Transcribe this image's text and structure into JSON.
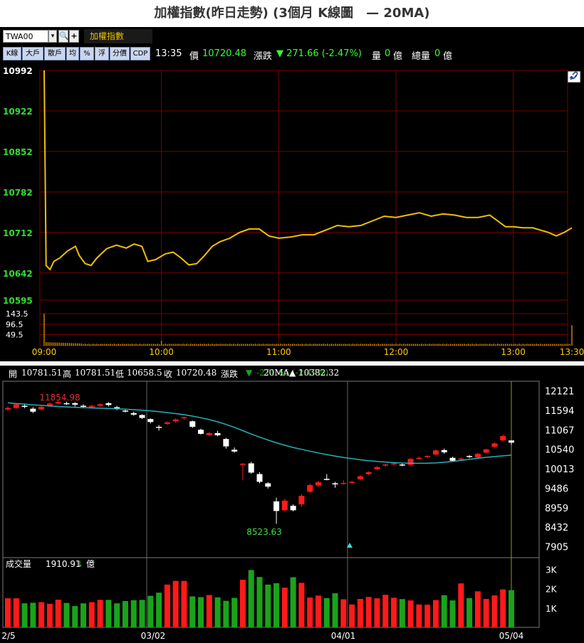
{
  "title": "加權指數(昨日走勢) (3個月 K線圖　— 20MA)",
  "toolbar": {
    "code_value": "TWA00",
    "dropdown_glyph": "▾",
    "zoom_glyph": "🔍",
    "add_glyph": "+",
    "name": "加權指數",
    "buttons": [
      "K線",
      "大戶",
      "散戶",
      "均",
      "%",
      "浮",
      "分價",
      "CDP"
    ],
    "time": "13:35",
    "price_label": "價",
    "price": "10720.48",
    "change_label": "漲跌",
    "change": "▼ 271.66 (-2.47%)",
    "volume_label": "量",
    "volume": "0",
    "volume_unit": "億",
    "total_label": "總量",
    "total": "0",
    "total_unit": "億"
  },
  "colors": {
    "up": "#ff1a1a",
    "down": "#1aa31a",
    "price_line": "#f0c000",
    "ma_line": "#26b0b8",
    "grid": "#7a0000",
    "axis_green": "#33dd33"
  },
  "chart_data": [
    {
      "type": "line",
      "title": "",
      "ylim": [
        10595,
        10992
      ],
      "y_ticks": [
        "10992",
        "10922",
        "10852",
        "10782",
        "10712",
        "10642",
        "10595"
      ],
      "x_ticks": [
        "09:00",
        "10:00",
        "11:00",
        "12:00",
        "13:00",
        "13:30"
      ],
      "x_range_minutes": [
        0,
        270
      ],
      "series": [
        {
          "points": [
            [
              0,
              10992
            ],
            [
              1,
              10655
            ],
            [
              3,
              10648
            ],
            [
              5,
              10662
            ],
            [
              8,
              10668
            ],
            [
              12,
              10680
            ],
            [
              16,
              10688
            ],
            [
              18,
              10672
            ],
            [
              21,
              10658
            ],
            [
              24,
              10655
            ],
            [
              27,
              10668
            ],
            [
              32,
              10684
            ],
            [
              37,
              10690
            ],
            [
              42,
              10685
            ],
            [
              46,
              10692
            ],
            [
              50,
              10688
            ],
            [
              53,
              10662
            ],
            [
              57,
              10665
            ],
            [
              62,
              10675
            ],
            [
              66,
              10678
            ],
            [
              70,
              10668
            ],
            [
              74,
              10656
            ],
            [
              78,
              10658
            ],
            [
              82,
              10672
            ],
            [
              86,
              10688
            ],
            [
              90,
              10696
            ],
            [
              95,
              10702
            ],
            [
              100,
              10712
            ],
            [
              105,
              10718
            ],
            [
              110,
              10718
            ],
            [
              115,
              10706
            ],
            [
              120,
              10702
            ],
            [
              126,
              10704
            ],
            [
              132,
              10708
            ],
            [
              138,
              10708
            ],
            [
              144,
              10716
            ],
            [
              150,
              10724
            ],
            [
              156,
              10722
            ],
            [
              162,
              10724
            ],
            [
              168,
              10732
            ],
            [
              174,
              10740
            ],
            [
              180,
              10738
            ],
            [
              186,
              10742
            ],
            [
              192,
              10746
            ],
            [
              198,
              10740
            ],
            [
              204,
              10744
            ],
            [
              210,
              10742
            ],
            [
              216,
              10738
            ],
            [
              222,
              10738
            ],
            [
              228,
              10742
            ],
            [
              232,
              10732
            ],
            [
              236,
              10722
            ],
            [
              240,
              10722
            ],
            [
              245,
              10720
            ],
            [
              250,
              10720
            ],
            [
              254,
              10716
            ],
            [
              258,
              10712
            ],
            [
              262,
              10706
            ],
            [
              266,
              10712
            ],
            [
              270,
              10720
            ]
          ],
          "close": 10720.48
        }
      ],
      "volume_ticks": [
        "143.5",
        "96.5",
        "49.5"
      ],
      "volume_max": 150,
      "volume_spikes": [
        [
          0,
          143
        ],
        [
          60,
          22
        ],
        [
          270,
          92
        ]
      ],
      "volume_base": 10
    },
    {
      "type": "candlestick",
      "header": {
        "open_label": "開",
        "open": "10781.51",
        "high_label": "高",
        "high": "10781.51",
        "low_label": "低",
        "low": "10658.5",
        "close_label": "收",
        "close": "10720.48",
        "change_label": "漲跌",
        "change": "-271.66 (-2.47%)",
        "ma_label": "20MA",
        "ma_value": "▲ 10382.32"
      },
      "y_ticks": [
        "12121",
        "11594",
        "11067",
        "10540",
        "10013",
        "9486",
        "8959",
        "8432",
        "7905"
      ],
      "ylim": [
        7645,
        12384
      ],
      "x_ticks": [
        "2/5",
        "03/02",
        "04/01",
        "05/04"
      ],
      "annotations": [
        {
          "text": "11854.98",
          "kind": "high"
        },
        {
          "text": "8523.63",
          "kind": "low"
        }
      ],
      "candles": [
        [
          11620,
          11660,
          11700,
          11580
        ],
        [
          11660,
          11760,
          11790,
          11630
        ],
        [
          11720,
          11690,
          11760,
          11650
        ],
        [
          11640,
          11560,
          11680,
          11520
        ],
        [
          11620,
          11690,
          11720,
          11590
        ],
        [
          11720,
          11780,
          11810,
          11690
        ],
        [
          11780,
          11820,
          11855,
          11760
        ],
        [
          11790,
          11780,
          11830,
          11740
        ],
        [
          11790,
          11750,
          11820,
          11700
        ],
        [
          11720,
          11700,
          11760,
          11660
        ],
        [
          11680,
          11720,
          11740,
          11640
        ],
        [
          11720,
          11760,
          11790,
          11690
        ],
        [
          11790,
          11740,
          11820,
          11700
        ],
        [
          11680,
          11650,
          11720,
          11600
        ],
        [
          11590,
          11570,
          11640,
          11540
        ],
        [
          11520,
          11480,
          11560,
          11450
        ],
        [
          11470,
          11390,
          11490,
          11360
        ],
        [
          11360,
          11280,
          11380,
          11240
        ],
        [
          11150,
          11130,
          11200,
          11050
        ],
        [
          11230,
          11270,
          11300,
          11200
        ],
        [
          11300,
          11350,
          11380,
          11260
        ],
        [
          11380,
          11410,
          11430,
          11340
        ],
        [
          11300,
          11150,
          11320,
          11120
        ],
        [
          11070,
          10960,
          11100,
          10940
        ],
        [
          10920,
          10980,
          11010,
          10900
        ],
        [
          10980,
          10920,
          11040,
          10890
        ],
        [
          10820,
          10620,
          10850,
          10560
        ],
        [
          10530,
          10480,
          10590,
          10450
        ],
        [
          10130,
          10150,
          10170,
          9700
        ],
        [
          10160,
          9910,
          10200,
          9880
        ],
        [
          9870,
          9660,
          9920,
          9620
        ],
        [
          9620,
          9530,
          9650,
          9480
        ],
        [
          9130,
          8870,
          9230,
          8524
        ],
        [
          8890,
          9150,
          9210,
          8860
        ],
        [
          9010,
          8890,
          9050,
          8860
        ],
        [
          9050,
          9280,
          9330,
          8980
        ],
        [
          9390,
          9570,
          9610,
          9350
        ],
        [
          9560,
          9650,
          9690,
          9520
        ],
        [
          9740,
          9720,
          9870,
          9700
        ],
        [
          9620,
          9590,
          9660,
          9500
        ],
        [
          9610,
          9630,
          9700,
          9580
        ],
        [
          9640,
          9660,
          9690,
          9610
        ],
        [
          9730,
          9810,
          9850,
          9700
        ],
        [
          9870,
          9920,
          9950,
          9840
        ],
        [
          10000,
          10060,
          10090,
          9980
        ],
        [
          10100,
          10130,
          10150,
          10070
        ],
        [
          10140,
          10160,
          10190,
          10090
        ],
        [
          10130,
          10110,
          10160,
          10080
        ],
        [
          10120,
          10280,
          10310,
          10110
        ],
        [
          10300,
          10310,
          10350,
          10270
        ],
        [
          10340,
          10360,
          10380,
          10300
        ],
        [
          10400,
          10510,
          10540,
          10380
        ],
        [
          10520,
          10460,
          10560,
          10420
        ],
        [
          10310,
          10230,
          10340,
          10200
        ],
        [
          10280,
          10290,
          10330,
          10240
        ],
        [
          10360,
          10340,
          10380,
          10300
        ],
        [
          10320,
          10420,
          10440,
          10300
        ],
        [
          10450,
          10540,
          10560,
          10430
        ],
        [
          10610,
          10700,
          10730,
          10590
        ],
        [
          10780,
          10900,
          10940,
          10760
        ],
        [
          10781.51,
          10720.48,
          10781.51,
          10658.5
        ]
      ],
      "ma20": [
        11800,
        11780,
        11765,
        11745,
        11730,
        11715,
        11700,
        11688,
        11678,
        11670,
        11662,
        11654,
        11646,
        11638,
        11628,
        11614,
        11598,
        11582,
        11560,
        11535,
        11508,
        11478,
        11440,
        11395,
        11345,
        11285,
        11215,
        11135,
        11045,
        10955,
        10870,
        10790,
        10718,
        10650,
        10590,
        10540,
        10490,
        10442,
        10398,
        10358,
        10320,
        10288,
        10258,
        10232,
        10212,
        10196,
        10180,
        10168,
        10162,
        10160,
        10164,
        10172,
        10190,
        10212,
        10240,
        10270,
        10298,
        10322,
        10344,
        10364,
        10382
      ],
      "volume_label": "成交量",
      "volume_value": "1910.91",
      "volume_arrow": "↓",
      "volume_unit": "億",
      "volume_ticks": [
        "3K",
        "2K",
        "1K"
      ],
      "volume_max": 3600,
      "volumes": [
        1500,
        1500,
        1240,
        1270,
        1300,
        1220,
        1430,
        1260,
        1100,
        1240,
        1300,
        1420,
        1420,
        1240,
        1360,
        1400,
        1420,
        1630,
        1790,
        2210,
        2400,
        2400,
        1600,
        1560,
        1670,
        1550,
        1370,
        1520,
        2460,
        2960,
        2600,
        2210,
        2280,
        2050,
        2590,
        2300,
        1540,
        1640,
        1510,
        1760,
        1450,
        1180,
        1470,
        1570,
        1500,
        1680,
        1530,
        1460,
        1390,
        1180,
        1170,
        1410,
        1660,
        1390,
        2270,
        1510,
        1860,
        1470,
        1650,
        1960,
        1920
      ]
    }
  ]
}
